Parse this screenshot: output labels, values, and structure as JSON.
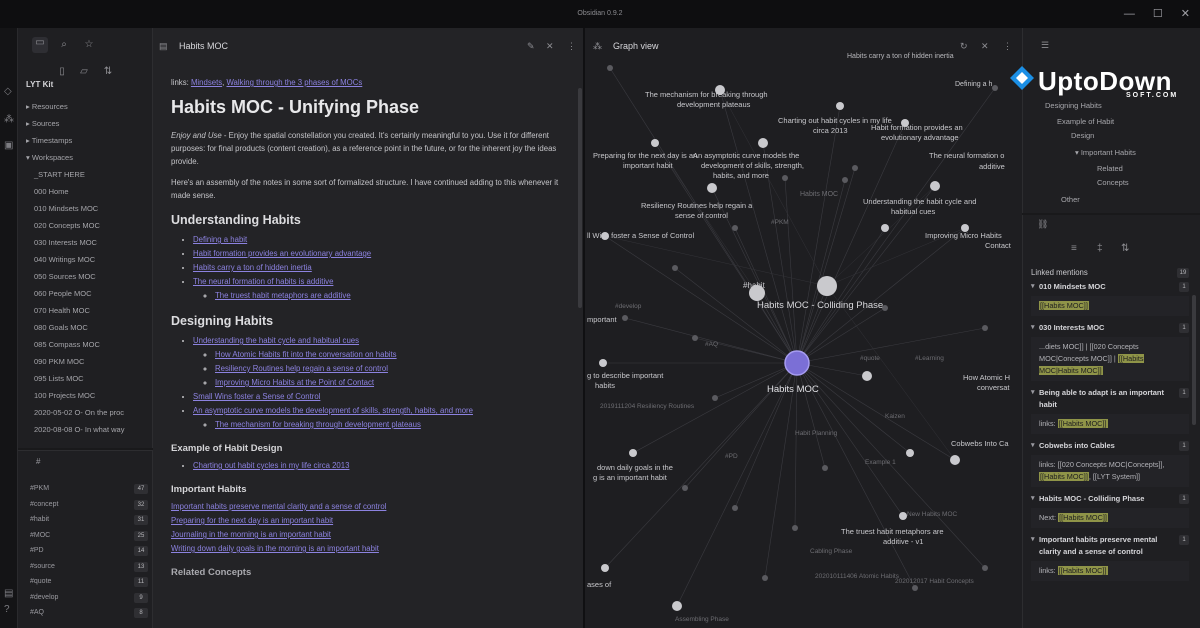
{
  "window": {
    "title": "Obsidian 0.9.2",
    "min": "—",
    "max": "☐",
    "close": "✕"
  },
  "left": {
    "vault_name": "LYT Kit",
    "tree": [
      "▸ Resources",
      "▸ Sources",
      "▸ Timestamps",
      "▾ Workspaces",
      "_START HERE",
      "000 Home",
      "010 Mindsets MOC",
      "020 Concepts MOC",
      "030 Interests MOC",
      "040 Writings MOC",
      "050 Sources MOC",
      "060 People MOC",
      "070 Health MOC",
      "080 Goals MOC",
      "085 Compass MOC",
      "090 PKM MOC",
      "095 Lists MOC",
      "100 Projects MOC",
      "2020-05-02 O- On the proc",
      "2020-08-08 O- In what way"
    ],
    "tags_tab": "#",
    "tags": [
      {
        "name": "#PKM",
        "count": "47"
      },
      {
        "name": "#concept",
        "count": "32"
      },
      {
        "name": "#habit",
        "count": "31"
      },
      {
        "name": "#MOC",
        "count": "25"
      },
      {
        "name": "#PD",
        "count": "14"
      },
      {
        "name": "#source",
        "count": "13"
      },
      {
        "name": "#quote",
        "count": "11"
      },
      {
        "name": "#develop",
        "count": "9"
      },
      {
        "name": "#AQ",
        "count": "8"
      }
    ]
  },
  "editor": {
    "tab_title": "Habits MOC",
    "links_label": "links:",
    "link1": "Mindsets",
    "link_sep": ", ",
    "link2": "Walking through the 3 phases of MOCs",
    "h1": "Habits MOC - Unifying Phase",
    "intro_em": "Enjoy and Use",
    "intro_rest": " - Enjoy the spatial constellation you created. It's certainly meaningful to you. Use it for different purposes: for final products (content creation), as a reference point in the future, or for the inherent joy the ideas provide.",
    "para2": "Here's an assembly of the notes in some sort of formalized structure. I have continued adding to this whenever it made sense.",
    "sec1": "Understanding Habits",
    "sec1_items": [
      "Defining a habit",
      "Habit formation provides an evolutionary advantage",
      "Habits carry a ton of hidden inertia",
      "The neural formation of habits is additive"
    ],
    "sec1_sub": "The truest habit metaphors are additive",
    "sec2": "Designing Habits",
    "sec2_item1": "Understanding the habit cycle and habitual cues",
    "sec2_sub1": [
      "How Atomic Habits fit into the conversation on habits",
      "Resiliency Routines help regain a sense of control",
      "Improving Micro Habits at the Point of Contact"
    ],
    "sec2_item2": "Small Wins foster a Sense of Control",
    "sec2_item3": "An asymptotic curve models the development of skills, strength, habits, and more",
    "sec2_sub3": "The mechanism for breaking through development plateaus",
    "sec3": "Example of Habit Design",
    "sec3_item": "Charting out habit cycles in my life circa 2013",
    "sec4": "Important Habits",
    "sec4_links": [
      "Important habits preserve mental clarity and a sense of control",
      "Preparing for the next day is an important habit",
      "Journaling in the morning is an important habit",
      "Writing down daily goals in the morning is an important habit"
    ],
    "sec5": "Related Concepts"
  },
  "graph": {
    "tab_title": "Graph view",
    "labels": [
      {
        "t": "Habits carry a ton of hidden inertia"
      },
      {
        "t": "Defining a h"
      },
      {
        "t": "The mechanism for breaking through"
      },
      {
        "t": "development plateaus"
      },
      {
        "t": "Charting out habit cycles in my life"
      },
      {
        "t": "circa 2013"
      },
      {
        "t": "Habit formation provides an"
      },
      {
        "t": "evolutionary advantage"
      },
      {
        "t": "Preparing for the next day is an"
      },
      {
        "t": "important habit"
      },
      {
        "t": "An asymptotic curve models the"
      },
      {
        "t": "development of skills, strength,"
      },
      {
        "t": "habits, and more"
      },
      {
        "t": "The neural formation o"
      },
      {
        "t": "additive"
      },
      {
        "t": "Habits MOC"
      },
      {
        "t": "Resiliency Routines help regain a"
      },
      {
        "t": "sense of control"
      },
      {
        "t": "Understanding the habit cycle and"
      },
      {
        "t": "habitual cues"
      },
      {
        "t": "ll Wins foster a Sense of Control"
      },
      {
        "t": "Improving Micro Habits"
      },
      {
        "t": "Contact"
      },
      {
        "t": "#habit"
      },
      {
        "t": "Habits MOC - Colliding Phase"
      },
      {
        "t": "mportant"
      },
      {
        "t": "Habits MOC"
      },
      {
        "t": "g to describe important"
      },
      {
        "t": "habits"
      },
      {
        "t": "How Atomic H"
      },
      {
        "t": "conversat"
      },
      {
        "t": "Cobwebs Into Ca"
      },
      {
        "t": "down daily goals in the"
      },
      {
        "t": "g is an important habit"
      },
      {
        "t": "The truest habit metaphors are"
      },
      {
        "t": "additive - v1"
      },
      {
        "t": "ases of"
      },
      {
        "t": "#PKM"
      },
      {
        "t": "#PD"
      },
      {
        "t": "#AQ"
      },
      {
        "t": "#quote"
      },
      {
        "t": "#Learning"
      },
      {
        "t": "#develop"
      },
      {
        "t": "202010111406 Atomic Habits"
      },
      {
        "t": "202012017 Habit Concepts"
      },
      {
        "t": "2019111204 Resiliency Routines"
      },
      {
        "t": "New Habits MOC"
      },
      {
        "t": "Example 1"
      },
      {
        "t": "Habit Planning"
      },
      {
        "t": "Cabling Phase"
      },
      {
        "t": "Kaizen"
      },
      {
        "t": "Assembling Phase"
      }
    ]
  },
  "outline": {
    "items": [
      "Designing Habits",
      "Example of Habit",
      "Design",
      "▾ Important Habits",
      "Related",
      "Concepts",
      "Other"
    ]
  },
  "backlinks": {
    "title": "Linked mentions",
    "count": "19",
    "groups": [
      {
        "title": "010 Mindsets MOC",
        "count": "1",
        "pre": "",
        "hl": "[[Habits MOC]]",
        "post": ""
      },
      {
        "title": "030 Interests MOC",
        "count": "1",
        "pre": "...diets MOC]] | [[020 Concepts MOC|Concepts MOC]] | ",
        "hl": "[[Habits MOC|Habits MOC]]",
        "post": ""
      },
      {
        "title": "Being able to adapt is an important habit",
        "count": "1",
        "pre": "links: ",
        "hl": "[[Habits MOC]]",
        "post": ""
      },
      {
        "title": "Cobwebs into Cables",
        "count": "1",
        "pre": "links: [[020 Concepts MOC|Concepts]], ",
        "hl": "[[Habits MOC]]",
        "post": ", [[LYT System]]"
      },
      {
        "title": "Habits MOC - Colliding Phase",
        "count": "1",
        "pre": "Next: ",
        "hl": "[[Habits MOC]]",
        "post": ""
      },
      {
        "title": "Important habits preserve mental clarity and a sense of control",
        "count": "1",
        "pre": "links: ",
        "hl": "[[Habits MOC]]",
        "post": ""
      }
    ]
  },
  "watermark": {
    "brand": "UptoDown",
    "sub": "SOFT.COM"
  },
  "colors": {
    "accent": "#8c82e0",
    "highlight": "#8f9448",
    "bg": "#19191b"
  }
}
